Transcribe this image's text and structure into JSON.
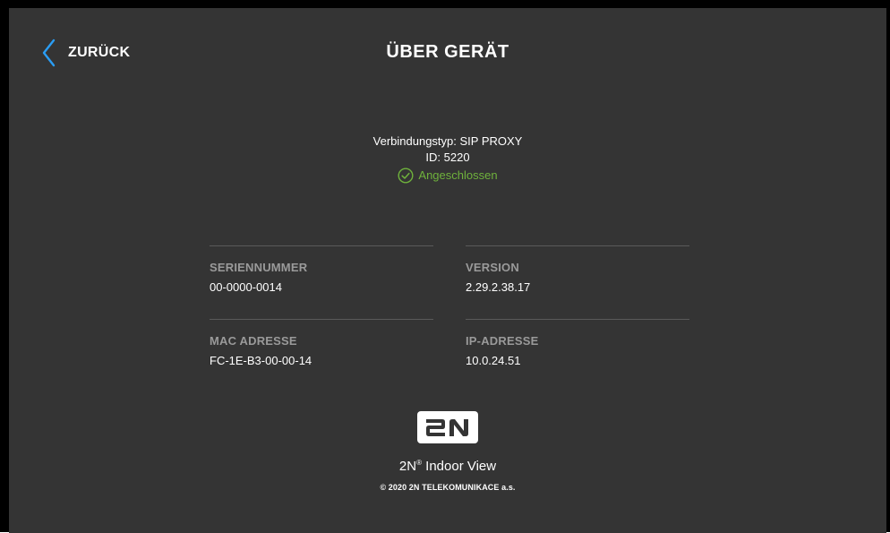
{
  "header": {
    "back_label": "ZURÜCK",
    "title": "ÜBER GERÄT"
  },
  "connection": {
    "type_line": "Verbindungstyp: SIP PROXY",
    "id_line": "ID: 5220",
    "status_text": "Angeschlossen",
    "status_color": "#6fb23c"
  },
  "info": {
    "serial": {
      "label": "SERIENNUMMER",
      "value": "00-0000-0014"
    },
    "version": {
      "label": "VERSION",
      "value": "2.29.2.38.17"
    },
    "mac": {
      "label": "MAC ADRESSE",
      "value": "FC-1E-B3-00-00-14"
    },
    "ip": {
      "label": "IP-ADRESSE",
      "value": "10.0.24.51"
    }
  },
  "brand": {
    "logo_text": "2N",
    "product_name": "2N",
    "product_registered": "®",
    "product_suffix": " Indoor View",
    "copyright": "© 2020 2N TELEKOMUNIKACE a.s."
  },
  "colors": {
    "background": "#343434",
    "accent": "#2a9df4",
    "label": "#9a9a9a",
    "divider": "#5a5a5a"
  },
  "icons": {
    "back": "chevron-left-icon",
    "status": "check-circle-icon",
    "logo": "2n-logo"
  }
}
